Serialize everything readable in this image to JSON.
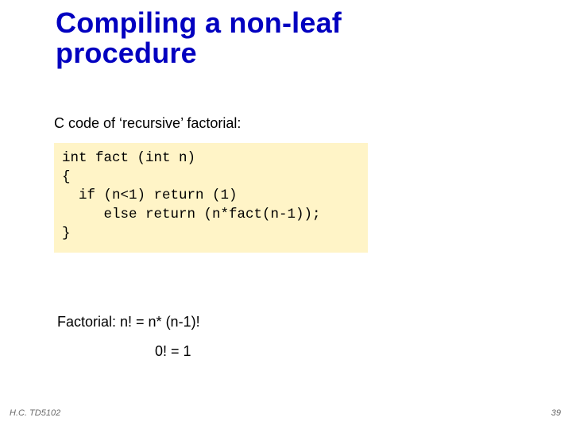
{
  "title_line1": "Compiling a non-leaf",
  "title_line2": "procedure",
  "subtitle": "C code of ‘recursive’ factorial:",
  "code": "int fact (int n)\n{\n  if (n<1) return (1)\n     else return (n*fact(n-1));\n}",
  "factorial_line1": "Factorial:   n! = n* (n-1)!",
  "factorial_line2": "0! = 1",
  "footer_left": "H.C. TD5102",
  "footer_right": "39"
}
